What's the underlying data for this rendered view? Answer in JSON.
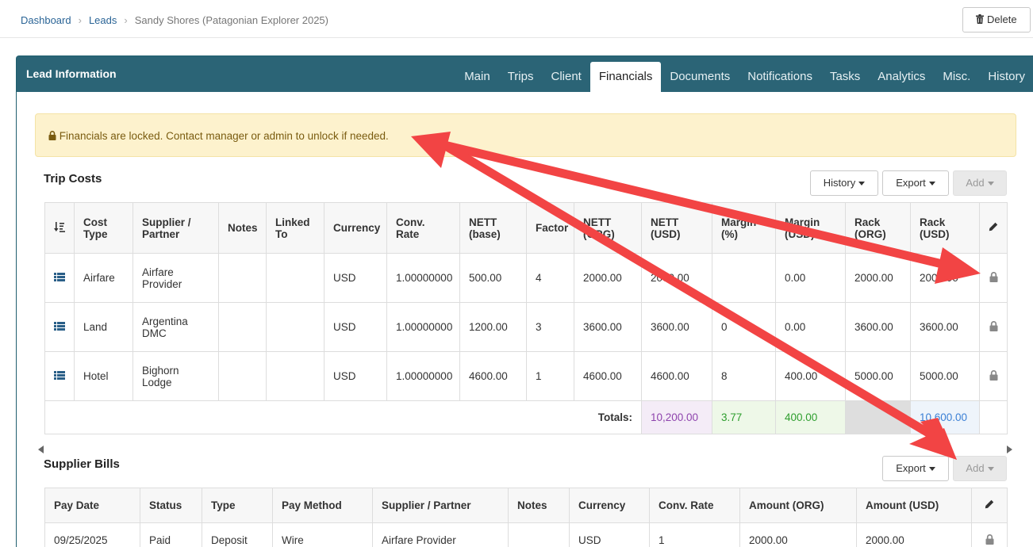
{
  "breadcrumb": {
    "items": [
      "Dashboard",
      "Leads"
    ],
    "current": "Sandy Shores (Patagonian Explorer 2025)"
  },
  "header": {
    "delete_label": "Delete"
  },
  "panel": {
    "title": "Lead Information",
    "tabs": [
      "Main",
      "Trips",
      "Client",
      "Financials",
      "Documents",
      "Notifications",
      "Tasks",
      "Analytics",
      "Misc.",
      "History"
    ],
    "active_tab": "Financials"
  },
  "alert": {
    "text": "Financials are locked. Contact manager or admin to unlock if needed."
  },
  "trip_costs": {
    "title": "Trip Costs",
    "buttons": {
      "history": "History",
      "export": "Export",
      "add": "Add"
    },
    "columns": [
      [
        "Cost",
        "Type"
      ],
      [
        "Supplier /",
        "Partner"
      ],
      [
        "Notes",
        ""
      ],
      [
        "Linked",
        "To"
      ],
      [
        "Currency",
        ""
      ],
      [
        "Conv. Rate",
        ""
      ],
      [
        "NETT",
        "(base)"
      ],
      [
        "Factor",
        ""
      ],
      [
        "NETT",
        "(ORG)"
      ],
      [
        "NETT",
        "(USD)"
      ],
      [
        "Margin",
        "(%)"
      ],
      [
        "Margin",
        "(USD)"
      ],
      [
        "Rack",
        "(ORG)"
      ],
      [
        "Rack",
        "(USD)"
      ]
    ],
    "rows": [
      {
        "cost_type": "Airfare",
        "supplier": [
          "Airfare",
          "Provider"
        ],
        "notes": "",
        "linked_to": "",
        "currency": "USD",
        "conv_rate": "1.00000000",
        "nett_base": "500.00",
        "factor": "4",
        "nett_org": "2000.00",
        "nett_usd": "2000.00",
        "margin_pct": "",
        "margin_usd": "0.00",
        "rack_org": "2000.00",
        "rack_usd": "2000.00"
      },
      {
        "cost_type": "Land",
        "supplier": [
          "Argentina",
          "DMC"
        ],
        "notes": "",
        "linked_to": "",
        "currency": "USD",
        "conv_rate": "1.00000000",
        "nett_base": "1200.00",
        "factor": "3",
        "nett_org": "3600.00",
        "nett_usd": "3600.00",
        "margin_pct": "0",
        "margin_usd": "0.00",
        "rack_org": "3600.00",
        "rack_usd": "3600.00"
      },
      {
        "cost_type": "Hotel",
        "supplier": [
          "Bighorn",
          "Lodge"
        ],
        "notes": "",
        "linked_to": "",
        "currency": "USD",
        "conv_rate": "1.00000000",
        "nett_base": "4600.00",
        "factor": "1",
        "nett_org": "4600.00",
        "nett_usd": "4600.00",
        "margin_pct": "8",
        "margin_usd": "400.00",
        "rack_org": "5000.00",
        "rack_usd": "5000.00"
      }
    ],
    "totals": {
      "label": "Totals:",
      "nett_usd": "10,200.00",
      "margin_pct": "3.77",
      "margin_usd": "400.00",
      "rack_usd": "10,600.00"
    }
  },
  "supplier_bills": {
    "title": "Supplier Bills",
    "buttons": {
      "export": "Export",
      "add": "Add"
    },
    "columns": [
      "Pay Date",
      "Status",
      "Type",
      "Pay Method",
      "Supplier / Partner",
      "Notes",
      "Currency",
      "Conv. Rate",
      "Amount (ORG)",
      "Amount (USD)"
    ],
    "rows": [
      {
        "pay_date": "09/25/2025",
        "status": "Paid",
        "type": "Deposit",
        "pay_method": "Wire",
        "supplier": "Airfare Provider",
        "notes": "",
        "currency": "USD",
        "conv_rate": "1",
        "amount_org": "2000.00",
        "amount_usd": "2000.00"
      }
    ]
  },
  "colors": {
    "header_bg": "#2b6476",
    "alert_bg": "#fdf2cd",
    "total_nett_bg": "#f4ecf7",
    "total_nett_text": "#8e44ad",
    "total_margin_bg": "#eef8e8",
    "total_margin_text": "#2e9e2e",
    "total_rack_bg": "#eef4fb",
    "total_rack_text": "#3a7fd5",
    "annotation_arrow": "#f24444"
  },
  "icons": {
    "drag": "list-icon",
    "sort": "sort-icon",
    "edit": "pencil-icon",
    "lock": "lock-icon",
    "trash": "trash-icon"
  }
}
